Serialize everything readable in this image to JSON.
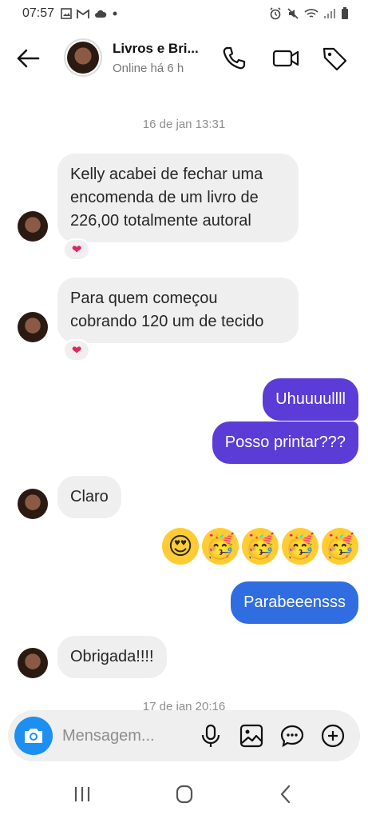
{
  "status_bar": {
    "time": "07:57"
  },
  "header": {
    "contact_name": "Livros e Bri...",
    "contact_status": "Online há 6 h"
  },
  "timestamps": {
    "first": "16 de jan 13:31",
    "second": "17 de jan 20:16"
  },
  "messages": [
    {
      "from": "contact",
      "text": "Kelly acabei de fechar uma encomenda de um livro de 226,00 totalmente autoral",
      "reaction": "heart"
    },
    {
      "from": "contact",
      "text": "Para quem começou cobrando 120 um de tecido",
      "reaction": "heart"
    },
    {
      "from": "me",
      "text": "Uhuuuullll"
    },
    {
      "from": "me",
      "text": "Posso printar???"
    },
    {
      "from": "contact",
      "text": "Claro"
    },
    {
      "from": "me",
      "type": "emoji",
      "emojis": [
        "😍",
        "🥳",
        "🥳",
        "🥳",
        "🥳"
      ]
    },
    {
      "from": "me",
      "text": "Parabeeensss"
    },
    {
      "from": "contact",
      "text": "Obrigada!!!!"
    }
  ],
  "composer": {
    "placeholder": "Mensagem..."
  },
  "colors": {
    "outgoing_purple": "#5b3cd6",
    "outgoing_blue": "#2f6de1",
    "incoming": "#efefef",
    "camera": "#1d8ff0",
    "reaction_heart": "#e0245e"
  }
}
